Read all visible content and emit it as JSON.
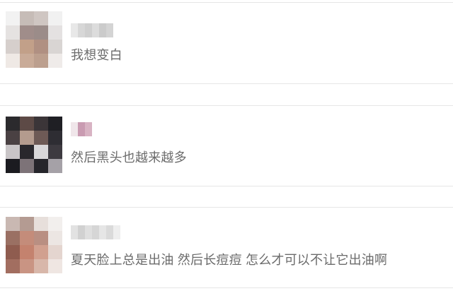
{
  "comments": [
    {
      "text": "我想变白"
    },
    {
      "text": "然后黑头也越来越多"
    },
    {
      "text": "夏天脸上总是出油 然后长痘痘 怎么才可以不让它出油啊"
    }
  ]
}
